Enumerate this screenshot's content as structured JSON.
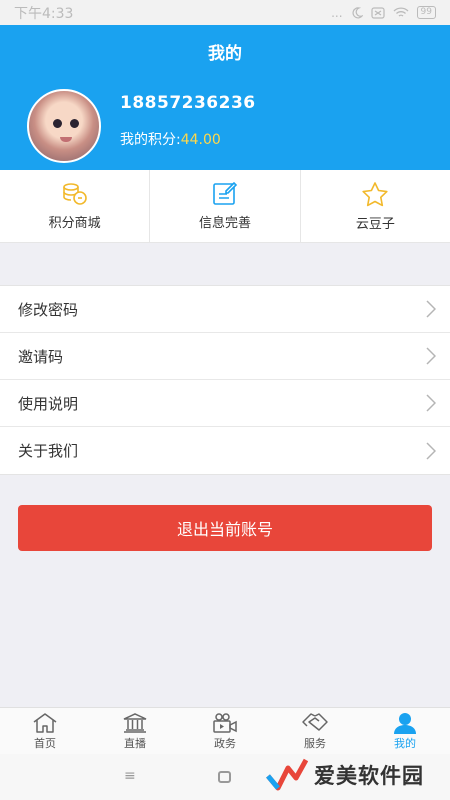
{
  "status_bar": {
    "time": "下午4:33",
    "signal": "...",
    "battery": "99"
  },
  "header": {
    "title": "我的",
    "phone": "18857236236",
    "points_label": "我的积分:",
    "points_value": "44.00"
  },
  "quick_actions": [
    {
      "label": "积分商城",
      "icon": "coins-icon"
    },
    {
      "label": "信息完善",
      "icon": "edit-profile-icon"
    },
    {
      "label": "云豆子",
      "icon": "star-icon"
    }
  ],
  "menu": [
    {
      "label": "修改密码"
    },
    {
      "label": "邀请码"
    },
    {
      "label": "使用说明"
    },
    {
      "label": "关于我们"
    }
  ],
  "logout_label": "退出当前账号",
  "tabs": [
    {
      "label": "首页",
      "icon": "home-icon"
    },
    {
      "label": "直播",
      "icon": "building-icon"
    },
    {
      "label": "政务",
      "icon": "video-camera-icon"
    },
    {
      "label": "服务",
      "icon": "handshake-icon"
    },
    {
      "label": "我的",
      "icon": "person-icon",
      "active": true
    }
  ],
  "nav_bar": {
    "menu_glyph": "≡"
  },
  "watermark": {
    "text": "爱美软件园"
  },
  "colors": {
    "primary": "#1aa2f0",
    "logout": "#e8463a",
    "points": "#ffd84a",
    "accent_gold": "#f2b92c"
  }
}
